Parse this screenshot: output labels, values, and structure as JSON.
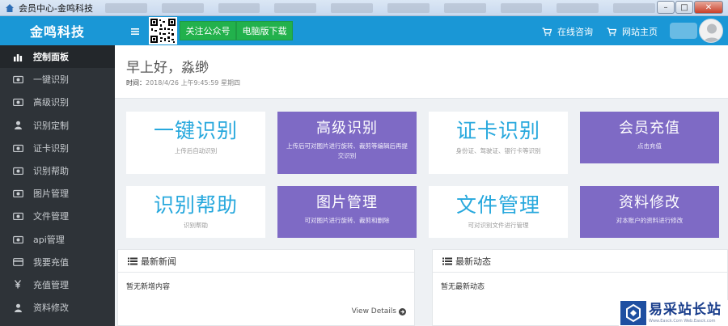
{
  "window": {
    "title": "会员中心-金鸣科技",
    "buttons": {
      "minimize": "–",
      "maximize": "□",
      "close": "✕"
    }
  },
  "brand": "金鸣科技",
  "sidebar": {
    "items": [
      {
        "label": "控制面板",
        "icon": "bar-chart-icon",
        "active": true
      },
      {
        "label": "一键识别",
        "icon": "camera-icon"
      },
      {
        "label": "高级识别",
        "icon": "camera-icon"
      },
      {
        "label": "识别定制",
        "icon": "user-icon"
      },
      {
        "label": "证卡识别",
        "icon": "camera-icon"
      },
      {
        "label": "识别帮助",
        "icon": "camera-icon"
      },
      {
        "label": "图片管理",
        "icon": "camera-icon"
      },
      {
        "label": "文件管理",
        "icon": "camera-icon"
      },
      {
        "label": "api管理",
        "icon": "camera-icon"
      },
      {
        "label": "我要充值",
        "icon": "credit-card-icon"
      },
      {
        "label": "充值管理",
        "icon": "yen-icon"
      },
      {
        "label": "资料修改",
        "icon": "user-icon"
      }
    ]
  },
  "topbar": {
    "follow_wechat": "关注公众号",
    "desktop_download": "电脑版下载",
    "online_consult": "在线咨询",
    "site_home": "网站主页"
  },
  "greeting": {
    "text": "早上好，淼缈",
    "time_label": "时间：",
    "time_value": "2018/4/26 上午9:45:59 星期四"
  },
  "tiles": [
    {
      "title": "一键识别",
      "subtitle": "上传后自动识别",
      "style": "white"
    },
    {
      "title": "高级识别",
      "subtitle": "上传后可对图片进行旋转、裁剪等编辑后再提交识别",
      "style": "purple"
    },
    {
      "title": "证卡识别",
      "subtitle": "身份证、驾驶证、银行卡等识别",
      "style": "white"
    },
    {
      "title": "会员充值",
      "subtitle": "点击充值",
      "style": "purple"
    },
    {
      "title": "识别帮助",
      "subtitle": "识别帮助",
      "style": "white"
    },
    {
      "title": "图片管理",
      "subtitle": "可对图片进行旋转、裁剪和删除",
      "style": "purple"
    },
    {
      "title": "文件管理",
      "subtitle": "可对识别文件进行管理",
      "style": "white"
    },
    {
      "title": "资料修改",
      "subtitle": "对本账户的资料进行修改",
      "style": "purple"
    }
  ],
  "news": {
    "title": "最新新闻",
    "empty": "暂无新增内容",
    "view_details": "View Details"
  },
  "activity": {
    "title": "最新动态",
    "empty": "暂无最新动态"
  },
  "watermark": {
    "main": "易采站长站",
    "sub": "Www.Easck.Com  Web.Easck.com"
  },
  "colors": {
    "primary": "#1a97d6",
    "sidebar": "#2e3338",
    "tile_purple": "#7e6ac5",
    "tile_text_blue": "#27a8dd",
    "green": "#22b14c"
  }
}
